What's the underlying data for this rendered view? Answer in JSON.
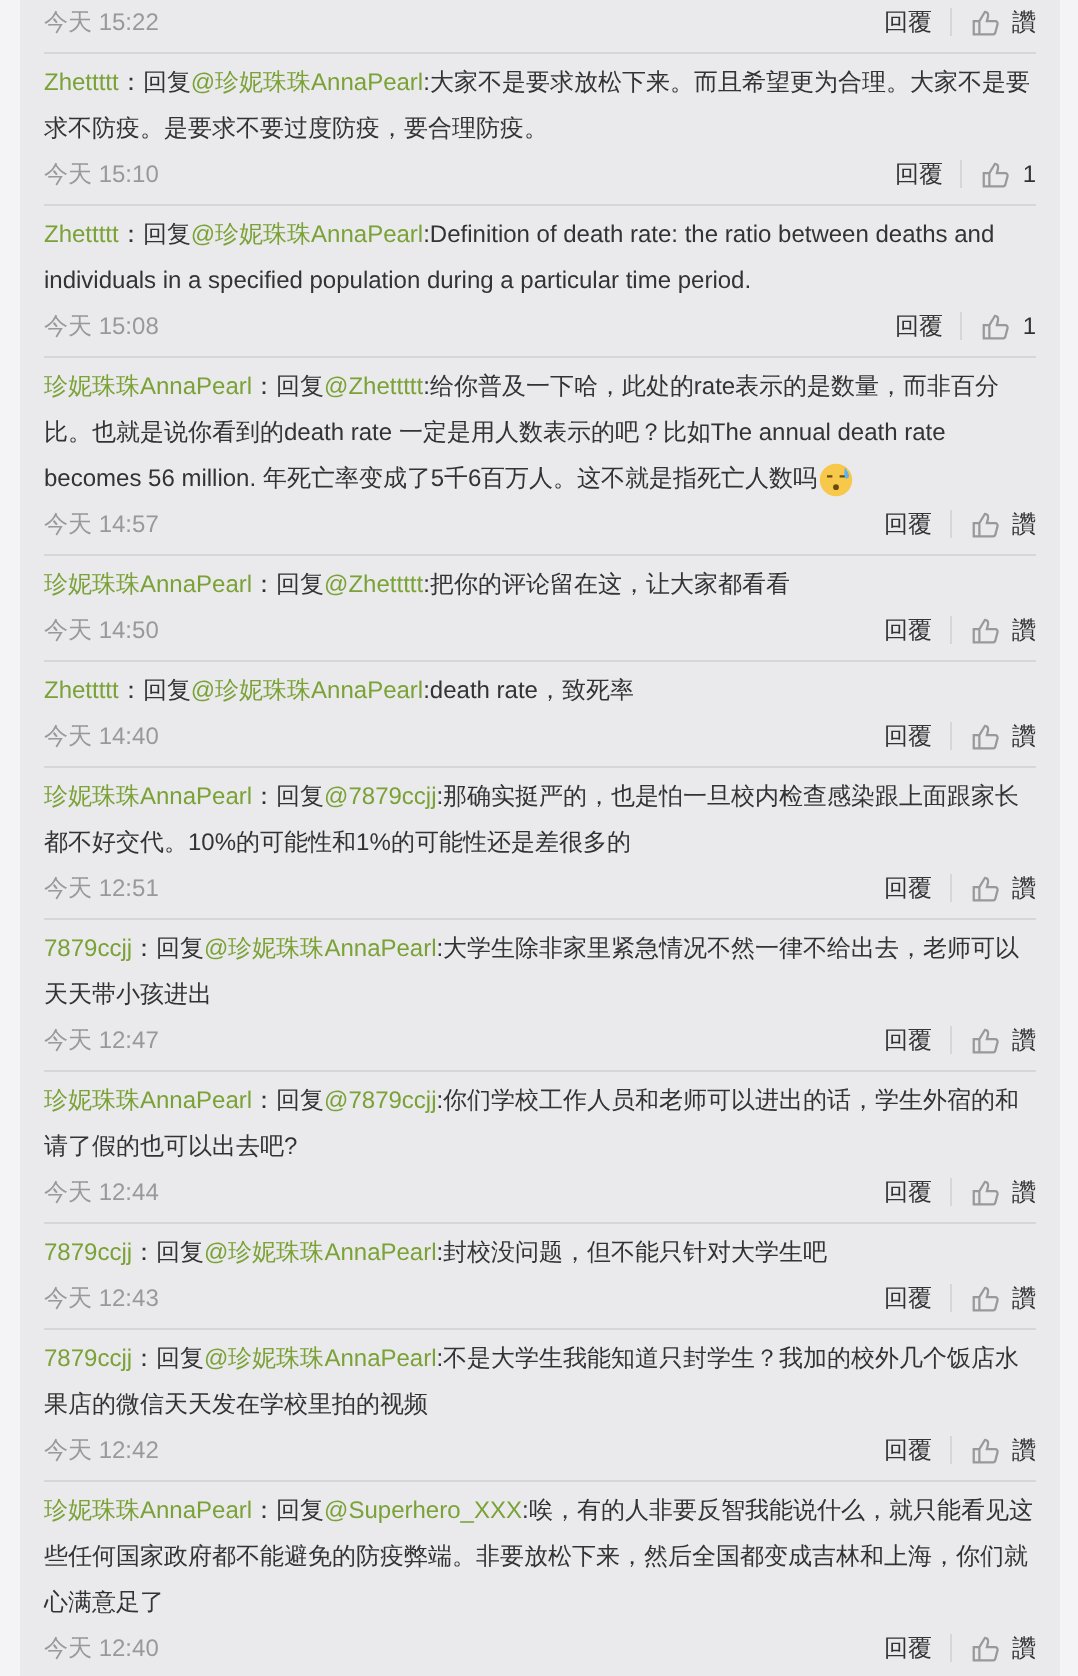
{
  "comments": [
    {
      "time": "今天 15:22",
      "reply_button": "回覆",
      "likes": "讚",
      "emoji": false
    },
    {
      "user": "Zhettttt",
      "reply_prefix": "：回复",
      "mention": "@珍妮珠珠AnnaPearl",
      "text": ":大家不是要求放松下来。而且希望更为合理。大家不是要求不防疫。是要求不要过度防疫，要合理防疫。",
      "time": "今天 15:10",
      "reply_button": "回覆",
      "likes": "1",
      "emoji": false
    },
    {
      "user": "Zhettttt",
      "reply_prefix": "：回复",
      "mention": "@珍妮珠珠AnnaPearl",
      "text": ":Definition of death rate: the ratio between deaths and individuals in a specified population during a particular time period.",
      "time": "今天 15:08",
      "reply_button": "回覆",
      "likes": "1",
      "emoji": false
    },
    {
      "user": "珍妮珠珠AnnaPearl",
      "reply_prefix": "：回复",
      "mention": "@Zhettttt",
      "text": ":给你普及一下哈，此处的rate表示的是数量，而非百分比。也就是说你看到的death rate 一定是用人数表示的吧？比如The annual death rate becomes 56 million. 年死亡率变成了5千6百万人。这不就是指死亡人数吗",
      "time": "今天 14:57",
      "reply_button": "回覆",
      "likes": "讚",
      "emoji": true
    },
    {
      "user": "珍妮珠珠AnnaPearl",
      "reply_prefix": "：回复",
      "mention": "@Zhettttt",
      "text": ":把你的评论留在这，让大家都看看",
      "time": "今天 14:50",
      "reply_button": "回覆",
      "likes": "讚",
      "emoji": false
    },
    {
      "user": "Zhettttt",
      "reply_prefix": "：回复",
      "mention": "@珍妮珠珠AnnaPearl",
      "text": ":death rate，致死率",
      "time": "今天 14:40",
      "reply_button": "回覆",
      "likes": "讚",
      "emoji": false
    },
    {
      "user": "珍妮珠珠AnnaPearl",
      "reply_prefix": "：回复",
      "mention": "@7879ccjj",
      "text": ":那确实挺严的，也是怕一旦校内检查感染跟上面跟家长都不好交代。10%的可能性和1%的可能性还是差很多的",
      "time": "今天 12:51",
      "reply_button": "回覆",
      "likes": "讚",
      "emoji": false
    },
    {
      "user": "7879ccjj",
      "reply_prefix": "：回复",
      "mention": "@珍妮珠珠AnnaPearl",
      "text": ":大学生除非家里紧急情况不然一律不给出去，老师可以天天带小孩进出",
      "time": "今天 12:47",
      "reply_button": "回覆",
      "likes": "讚",
      "emoji": false
    },
    {
      "user": "珍妮珠珠AnnaPearl",
      "reply_prefix": "：回复",
      "mention": "@7879ccjj",
      "text": ":你们学校工作人员和老师可以进出的话，学生外宿的和请了假的也可以出去吧?",
      "time": "今天 12:44",
      "reply_button": "回覆",
      "likes": "讚",
      "emoji": false
    },
    {
      "user": "7879ccjj",
      "reply_prefix": "：回复",
      "mention": "@珍妮珠珠AnnaPearl",
      "text": ":封校没问题，但不能只针对大学生吧",
      "time": "今天 12:43",
      "reply_button": "回覆",
      "likes": "讚",
      "emoji": false
    },
    {
      "user": "7879ccjj",
      "reply_prefix": "：回复",
      "mention": "@珍妮珠珠AnnaPearl",
      "text": ":不是大学生我能知道只封学生？我加的校外几个饭店水果店的微信天天发在学校里拍的视频",
      "time": "今天 12:42",
      "reply_button": "回覆",
      "likes": "讚",
      "emoji": false
    },
    {
      "user": "珍妮珠珠AnnaPearl",
      "reply_prefix": "：回复",
      "mention": "@Superhero_XXX",
      "text": ":唉，有的人非要反智我能说什么，就只能看见这些任何国家政府都不能避免的防疫弊端。非要放松下来，然后全国都变成吉林和上海，你们就心满意足了",
      "time": "今天 12:40",
      "reply_button": "回覆",
      "likes": "讚",
      "emoji": false
    }
  ]
}
